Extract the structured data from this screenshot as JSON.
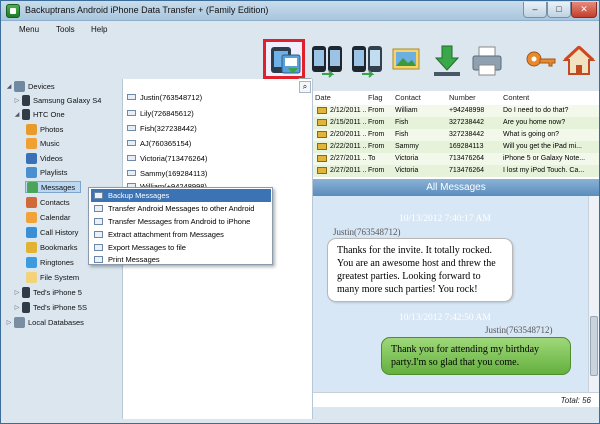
{
  "window": {
    "title": "Backuptrans Android iPhone Data Transfer + (Family Edition)",
    "controls": {
      "minimize": "–",
      "maximize": "□",
      "close": "✕"
    }
  },
  "menu": {
    "items": [
      "Menu",
      "Tools",
      "Help"
    ]
  },
  "toolbar": {
    "buttons": [
      {
        "icon": "backup-messages-icon"
      },
      {
        "icon": "transfer-android-icon"
      },
      {
        "icon": "transfer-iphone-icon"
      },
      {
        "icon": "extract-attachment-icon"
      },
      {
        "icon": "export-download-icon"
      },
      {
        "icon": "print-icon"
      },
      {
        "icon": "key-icon"
      },
      {
        "icon": "home-icon"
      }
    ]
  },
  "tree": {
    "devices": "Devices",
    "samsung": "Samsung Galaxy S4",
    "htc": "HTC One",
    "children": [
      "Photos",
      "Music",
      "Videos",
      "Playlists",
      "Messages",
      "Contacts",
      "Calendar",
      "Call History",
      "Bookmarks",
      "Ringtones",
      "File System"
    ],
    "iphone5": "Ted's iPhone 5",
    "iphone5s": "Ted's iPhone 5S",
    "local": "Local Databases"
  },
  "contacts": [
    "Justin(763548712)",
    "Lily(726845612)",
    "Fish(327238442)",
    "AJ(760365154)",
    "Victoria(713476264)",
    "Sammy(169284113)",
    "William(+94248998)"
  ],
  "messages": {
    "headers": [
      "Date",
      "Flag",
      "Contact",
      "Number",
      "Content"
    ],
    "rows": [
      [
        "2/12/2011 ...",
        "From",
        "William",
        "+94248998",
        "Do I need to do that?"
      ],
      [
        "2/15/2011 ...",
        "From",
        "Fish",
        "327238442",
        "Are you home now?"
      ],
      [
        "2/20/2011 ...",
        "From",
        "Fish",
        "327238442",
        "What is going on?"
      ],
      [
        "2/22/2011 ...",
        "From",
        "Sammy",
        "169284113",
        "Will you get the iPad mi..."
      ],
      [
        "2/27/2011 ...",
        "To",
        "Victoria",
        "713476264",
        "iPhone 5 or Galaxy Note..."
      ],
      [
        "2/27/2011 ...",
        "From",
        "Victoria",
        "713476264",
        "I lost my iPod Touch. Ca..."
      ]
    ]
  },
  "conversation": {
    "header": "All Messages",
    "items": [
      {
        "time": "10/13/2012 7:40:17 AM",
        "sender": "Justin(763548712)",
        "text": "Thanks for the invite. It totally rocked. You are an awesome host and threw the greatest parties. Looking forward to many more such parties! You rock!"
      },
      {
        "time": "10/13/2012 7:42:50 AM",
        "sender": "Justin(763548712)",
        "text": "Thank you for attending my birthday party.I'm so glad that you come."
      }
    ],
    "total": "Total: 56"
  },
  "context_menu": {
    "items": [
      "Backup Messages",
      "Transfer Android Messages to other Android",
      "Transfer Messages from Android to iPhone",
      "Extract attachment from Messages",
      "Export Messages to file",
      "Print Messages"
    ]
  },
  "colors": {
    "accent": "#3c73b5",
    "highlight": "#e0202a",
    "bubble_out": "#64b03e"
  }
}
